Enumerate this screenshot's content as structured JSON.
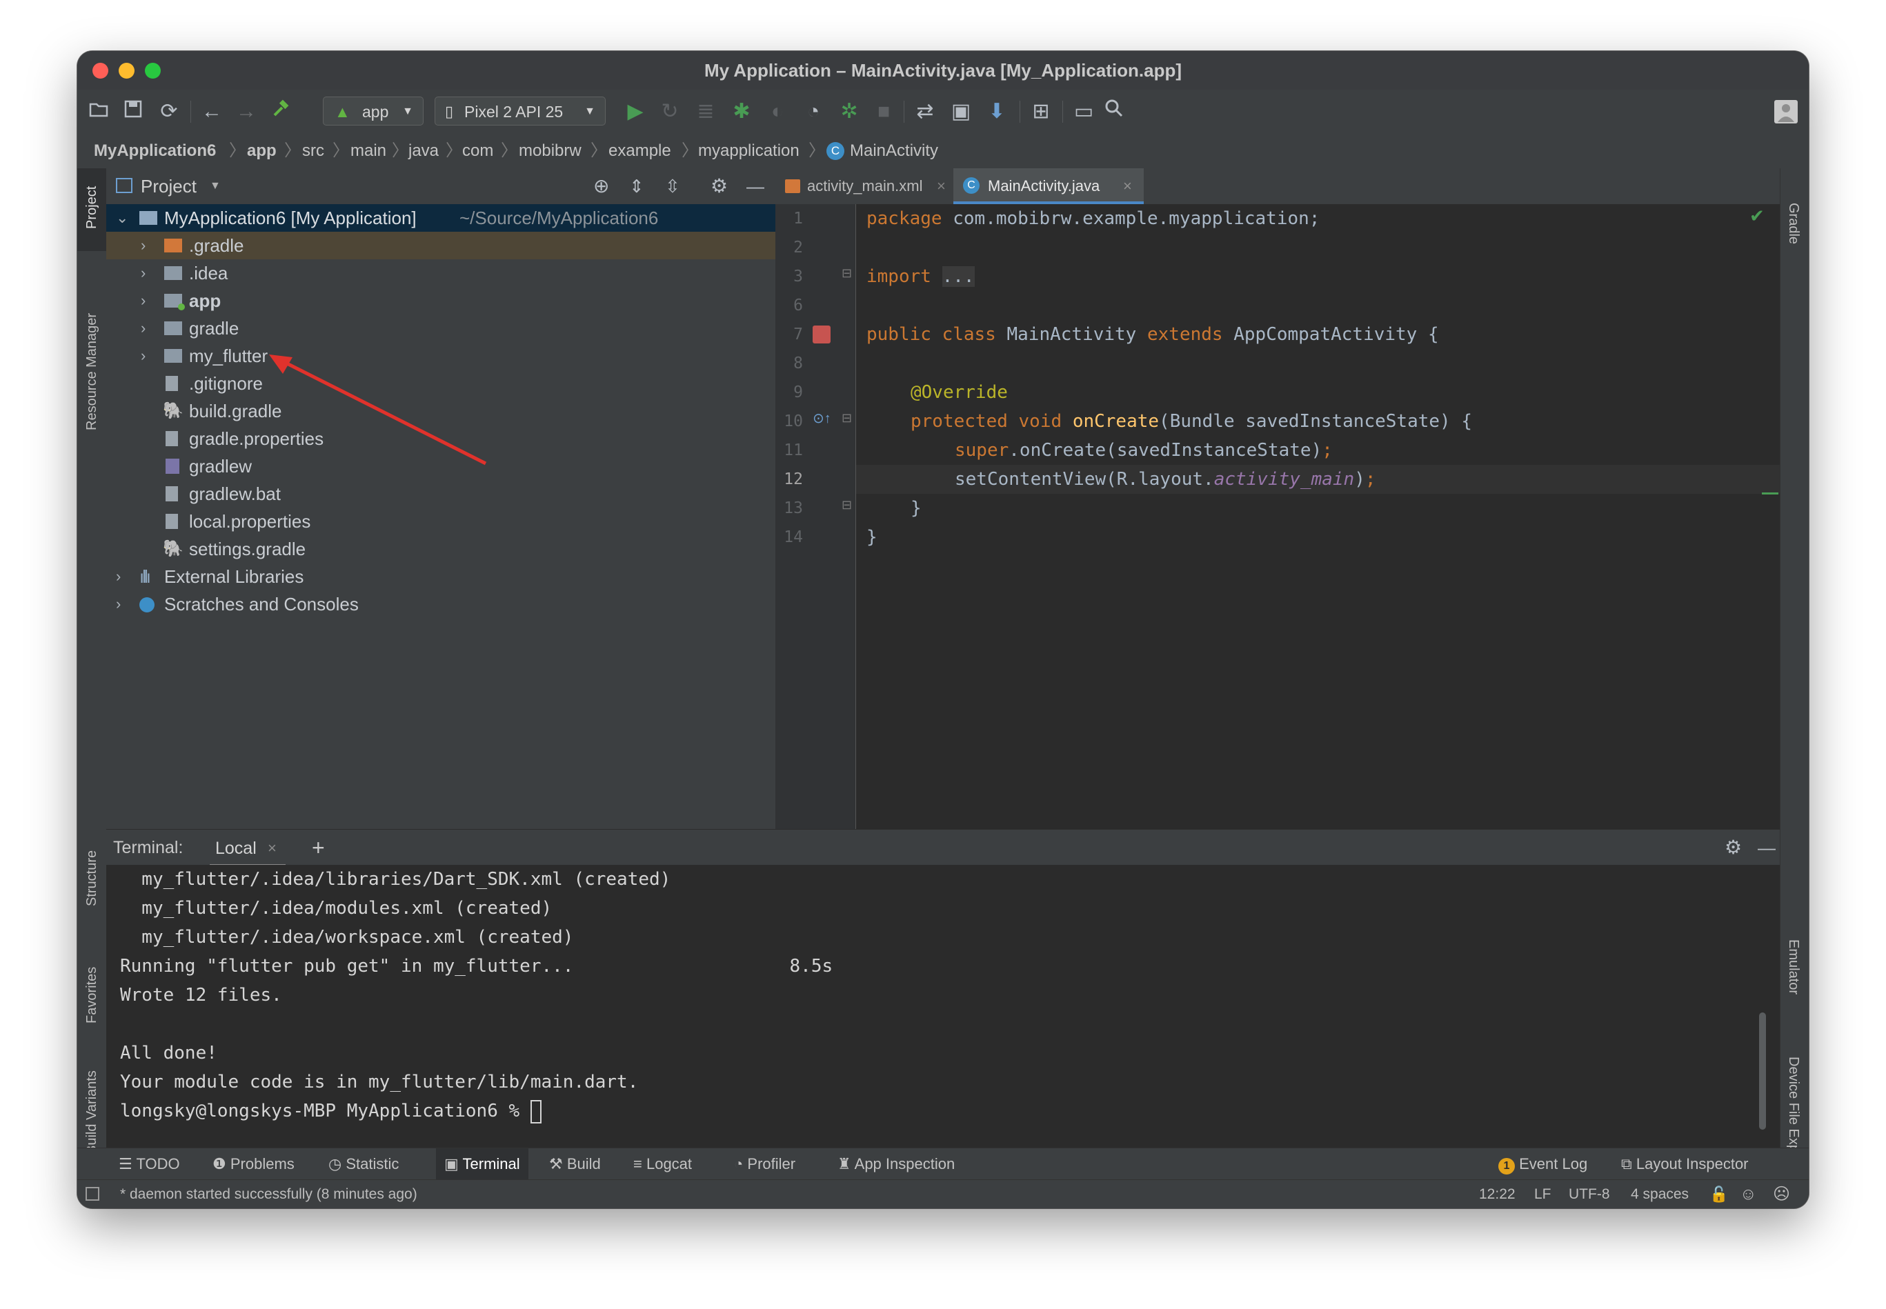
{
  "window": {
    "title": "My Application – MainActivity.java [My_Application.app]"
  },
  "toolbar": {
    "run_config": "app",
    "device": "Pixel 2 API 25"
  },
  "breadcrumb": [
    "MyApplication6",
    "app",
    "src",
    "main",
    "java",
    "com",
    "mobibrw",
    "example",
    "myapplication",
    "MainActivity"
  ],
  "left_stripe": {
    "project": "Project",
    "resource_manager": "Resource Manager",
    "structure": "Structure",
    "favorites": "Favorites",
    "build_variants": "Build Variants"
  },
  "right_stripe": {
    "gradle": "Gradle",
    "emulator": "Emulator",
    "device_file_explorer": "Device File Explorer"
  },
  "project_panel": {
    "header": "Project",
    "root_name": "MyApplication6 [My Application]",
    "root_path": "~/Source/MyApplication6",
    "items": [
      {
        "label": ".gradle"
      },
      {
        "label": ".idea"
      },
      {
        "label": "app"
      },
      {
        "label": "gradle"
      },
      {
        "label": "my_flutter"
      },
      {
        "label": ".gitignore"
      },
      {
        "label": "build.gradle"
      },
      {
        "label": "gradle.properties"
      },
      {
        "label": "gradlew"
      },
      {
        "label": "gradlew.bat"
      },
      {
        "label": "local.properties"
      },
      {
        "label": "settings.gradle"
      }
    ],
    "external_libraries": "External Libraries",
    "scratches": "Scratches and Consoles"
  },
  "editor": {
    "tabs": [
      {
        "label": "activity_main.xml"
      },
      {
        "label": "MainActivity.java"
      }
    ],
    "line_numbers": [
      "1",
      "2",
      "3",
      "6",
      "7",
      "8",
      "9",
      "10",
      "11",
      "12",
      "13",
      "14"
    ],
    "code": {
      "l1_kw": "package",
      "l1_rest": " com.mobibrw.example.myapplication;",
      "l3_kw": "import",
      "l3_fold": "...",
      "l7_a": "public class",
      "l7_b": " MainActivity ",
      "l7_c": "extends",
      "l7_d": " AppCompatActivity {",
      "l9": "@Override",
      "l10_a": "protected void",
      "l10_b": "onCreate",
      "l10_c": "(Bundle savedInstanceState) {",
      "l11_a": "super",
      "l11_b": ".onCreate(savedInstanceState)",
      "l11_c": ";",
      "l12_a": "setContentView(R.layout.",
      "l12_b": "activity_main",
      "l12_c": ")",
      "l12_d": ";",
      "l13": "}",
      "l14": "}"
    }
  },
  "terminal": {
    "label": "Terminal:",
    "tab": "Local",
    "lines": [
      "  my_flutter/.idea/libraries/Dart_SDK.xml (created)",
      "  my_flutter/.idea/modules.xml (created)",
      "  my_flutter/.idea/workspace.xml (created)",
      "Running \"flutter pub get\" in my_flutter...                    8.5s",
      "Wrote 12 files.",
      "",
      "All done!",
      "Your module code is in my_flutter/lib/main.dart.",
      "longsky@longskys-MBP MyApplication6 % "
    ]
  },
  "bottom_tools": {
    "todo": "TODO",
    "problems": "Problems",
    "statistic": "Statistic",
    "terminal": "Terminal",
    "build": "Build",
    "logcat": "Logcat",
    "profiler": "Profiler",
    "app_inspection": "App Inspection",
    "event_log_count": "1",
    "event_log": "Event Log",
    "layout_inspector": "Layout Inspector"
  },
  "status": {
    "message": "* daemon started successfully (8 minutes ago)",
    "position": "12:22",
    "line_sep": "LF",
    "encoding": "UTF-8",
    "indent": "4 spaces"
  },
  "colors": {
    "accent": "#4a88c7",
    "run_green": "#499c54",
    "annotation_red": "#e0322c"
  }
}
